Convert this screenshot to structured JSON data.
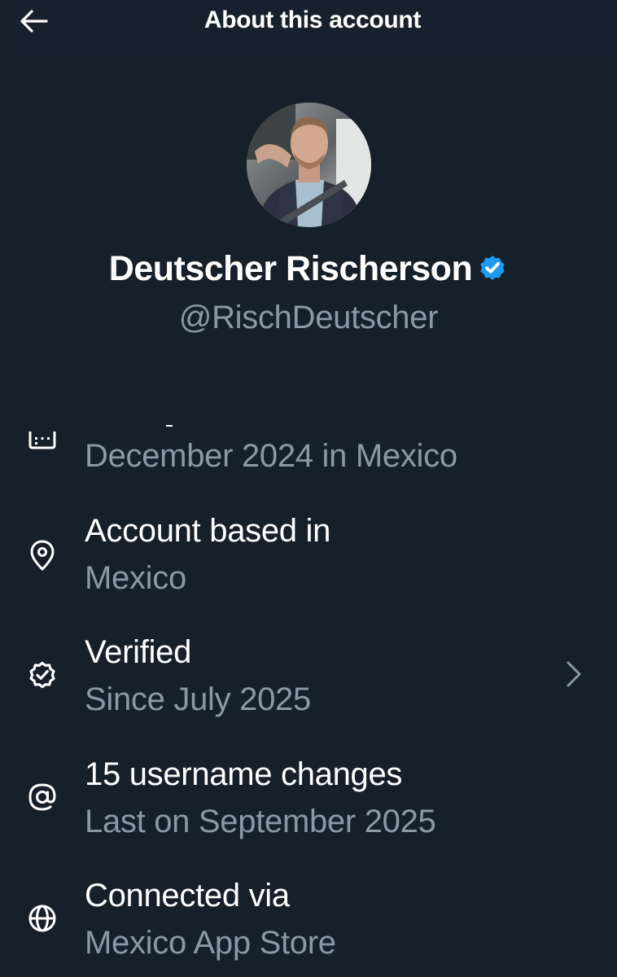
{
  "header": {
    "title": "About this account",
    "back_icon": "arrow-left-icon"
  },
  "profile": {
    "display_name": "Deutscher Rischerson",
    "handle": "@RischDeutscher",
    "verified_badge_color": "#1d9bf0"
  },
  "details": {
    "joined": {
      "icon": "calendar-icon",
      "subtitle": "December 2024 in Mexico"
    },
    "location": {
      "icon": "location-pin-icon",
      "title": "Account based in",
      "subtitle": "Mexico"
    },
    "verified": {
      "icon": "verified-seal-icon",
      "title": "Verified",
      "subtitle": "Since July 2025"
    },
    "username_changes": {
      "icon": "at-sign-icon",
      "title": "15 username changes",
      "subtitle": "Last on September 2025"
    },
    "connected": {
      "icon": "globe-icon",
      "title": "Connected via",
      "subtitle": "Mexico App Store"
    }
  },
  "colors": {
    "background": "#15202b",
    "primary_text": "#ffffff",
    "secondary_text": "#8b98a5",
    "accent": "#1d9bf0"
  }
}
